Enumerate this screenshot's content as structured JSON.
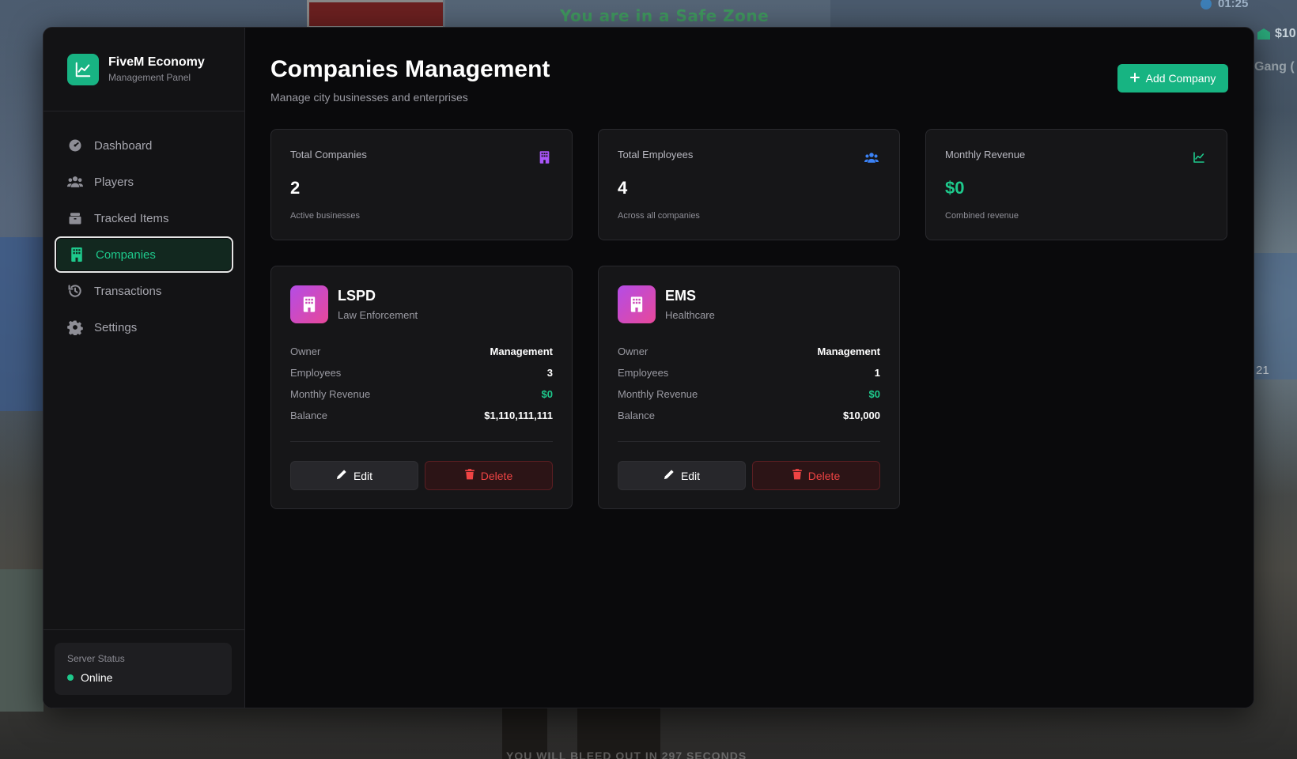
{
  "game_hud": {
    "zone_text": "You are in a Safe Zone",
    "time": "01:25",
    "money": "$10",
    "gang": "Gang (",
    "side_number": "21",
    "bottom_text": "YOU WILL BLEED OUT IN 297 SECONDS"
  },
  "brand": {
    "title": "FiveM Economy",
    "subtitle": "Management Panel",
    "icon": "chart-line-icon"
  },
  "nav": [
    {
      "label": "Dashboard",
      "icon": "gauge-icon",
      "active": false
    },
    {
      "label": "Players",
      "icon": "users-icon",
      "active": false
    },
    {
      "label": "Tracked Items",
      "icon": "box-icon",
      "active": false
    },
    {
      "label": "Companies",
      "icon": "building-icon",
      "active": true
    },
    {
      "label": "Transactions",
      "icon": "history-icon",
      "active": false
    },
    {
      "label": "Settings",
      "icon": "gear-icon",
      "active": false
    }
  ],
  "server": {
    "label": "Server Status",
    "status": "Online"
  },
  "header": {
    "title": "Companies Management",
    "subtitle": "Manage city businesses and enterprises",
    "add_button": "Add Company"
  },
  "stats": [
    {
      "label": "Total Companies",
      "value": "2",
      "note": "Active businesses",
      "icon": "building-icon",
      "color": "#a855f7"
    },
    {
      "label": "Total Employees",
      "value": "4",
      "note": "Across all companies",
      "icon": "users-icon",
      "color": "#3b82f6"
    },
    {
      "label": "Monthly Revenue",
      "value": "$0",
      "note": "Combined revenue",
      "icon": "chart-line-icon",
      "color": "#1ec98c"
    }
  ],
  "companies": [
    {
      "name": "LSPD",
      "type": "Law Enforcement",
      "owner_label": "Owner",
      "owner": "Management",
      "employees_label": "Employees",
      "employees": "3",
      "revenue_label": "Monthly Revenue",
      "revenue": "$0",
      "balance_label": "Balance",
      "balance": "$1,110,111,111",
      "edit_label": "Edit",
      "delete_label": "Delete"
    },
    {
      "name": "EMS",
      "type": "Healthcare",
      "owner_label": "Owner",
      "owner": "Management",
      "employees_label": "Employees",
      "employees": "1",
      "revenue_label": "Monthly Revenue",
      "revenue": "$0",
      "balance_label": "Balance",
      "balance": "$10,000",
      "edit_label": "Edit",
      "delete_label": "Delete"
    }
  ],
  "colors": {
    "accent": "#17b482",
    "danger": "#ef4444",
    "background": "#0a0a0c",
    "card": "#161618"
  }
}
